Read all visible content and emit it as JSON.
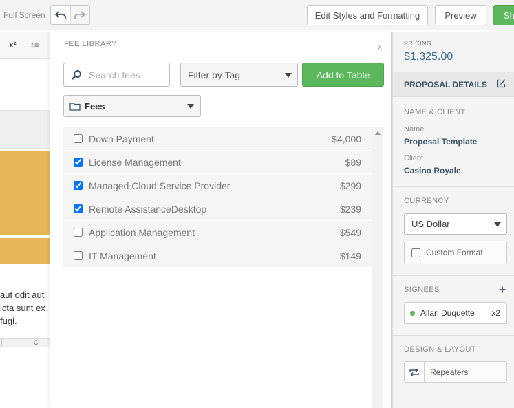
{
  "toolbar": {
    "fullscreen_label": "Full Screen",
    "undo_icon": "undo-arrow",
    "redo_icon": "redo-arrow",
    "edit_styles_label": "Edit Styles and Formatting",
    "preview_label": "Preview",
    "share_label": "Sh"
  },
  "editor": {
    "superscript_label": "x²",
    "line_height_label": "↕≡",
    "paragraph_lines": [
      "aut odit aut",
      "icta sunt ex",
      "fugi."
    ],
    "column_label": "C",
    "band_color": "#e6b754"
  },
  "fee_library": {
    "title": "FEE LIBRARY",
    "close": "x",
    "search_placeholder": "Search fees",
    "filter_label": "Filter by Tag",
    "add_button": "Add to Table",
    "folder_label": "Fees",
    "fees": [
      {
        "name": "Down Payment",
        "price": "$4,000",
        "checked": false
      },
      {
        "name": "License Management",
        "price": "$89",
        "checked": true
      },
      {
        "name": "Managed Cloud Service Provider",
        "price": "$299",
        "checked": true
      },
      {
        "name": "Remote AssistanceDesktop",
        "price": "$239",
        "checked": true
      },
      {
        "name": "Application Management",
        "price": "$549",
        "checked": false
      },
      {
        "name": "IT Management",
        "price": "$149",
        "checked": false
      }
    ]
  },
  "sidebar": {
    "pricing_label": "PRICING",
    "pricing_value": "$1,325.00",
    "details_title": "PROPOSAL DETAILS",
    "name_client_title": "NAME & CLIENT",
    "name_label": "Name",
    "name_value": "Proposal Template",
    "client_label": "Client",
    "client_value": "Casino Royale",
    "currency_title": "CURRENCY",
    "currency_value": "US Dollar",
    "custom_format_label": "Custom Format",
    "signees_title": "SIGNEES",
    "add_signee": "+",
    "signee_name": "Allan Duquette",
    "signee_count": "x2",
    "design_title": "DESIGN & LAYOUT",
    "repeaters_label": "Repeaters"
  },
  "colors": {
    "accent_green": "#5cb85c",
    "gold": "#e6b754",
    "link_blue": "#3a5569"
  }
}
